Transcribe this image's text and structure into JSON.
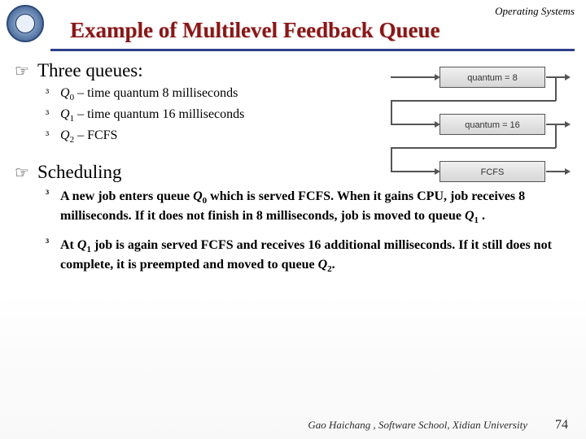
{
  "header": {
    "course": "Operating Systems"
  },
  "title": "Example of Multilevel Feedback Queue",
  "section1": {
    "heading": "Three queues:",
    "items": [
      {
        "q": "Q",
        "sub": "0",
        "rest": " – time quantum 8 milliseconds"
      },
      {
        "q": "Q",
        "sub": "1",
        "rest": " – time quantum 16 milliseconds"
      },
      {
        "q": "Q",
        "sub": "2",
        "rest": " – FCFS"
      }
    ]
  },
  "section2": {
    "heading": "Scheduling",
    "items": [
      {
        "pre": "A new job enters queue ",
        "q1": "Q",
        "s1": "0",
        "mid": " which is served FCFS. When it gains CPU, job receives 8 milliseconds.  If it does not finish in 8 milliseconds, job is moved to queue ",
        "q2": "Q",
        "s2": "1",
        "post": " ."
      },
      {
        "pre": "At ",
        "q1": "Q",
        "s1": "1",
        "mid": " job is again served FCFS and receives 16 additional milliseconds.  If it still does not complete, it is preempted and moved to queue ",
        "q2": "Q",
        "s2": "2",
        "post": "."
      }
    ]
  },
  "diagram": {
    "boxes": [
      "quantum = 8",
      "quantum = 16",
      "FCFS"
    ]
  },
  "footer": {
    "credit": "Gao Haichang , Software School, Xidian University",
    "page": "74"
  }
}
